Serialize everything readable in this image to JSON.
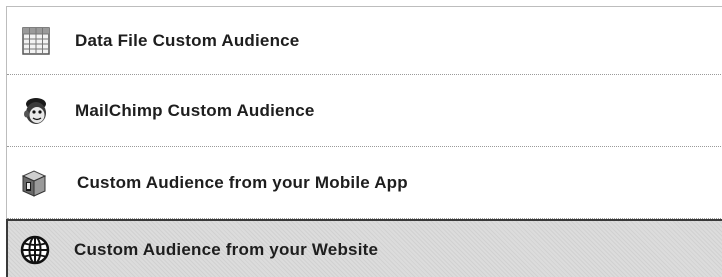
{
  "options": [
    {
      "label": "Data File Custom Audience",
      "icon": "spreadsheet-icon"
    },
    {
      "label": "MailChimp Custom Audience",
      "icon": "mailchimp-icon"
    },
    {
      "label": "Custom Audience from your Mobile App",
      "icon": "mobile-app-icon"
    },
    {
      "label": "Custom Audience from your Website",
      "icon": "globe-icon",
      "selected": true
    }
  ]
}
